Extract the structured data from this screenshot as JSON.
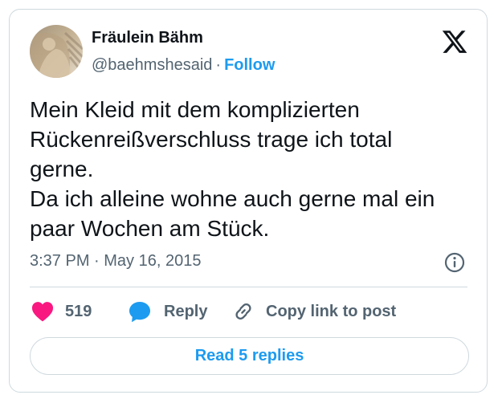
{
  "author": {
    "name": "Fräulein Bähm",
    "handle": "@baehmshesaid",
    "separator": "·",
    "follow_label": "Follow"
  },
  "tweet": {
    "lines": [
      "Mein Kleid mit dem komplizierten",
      "Rückenreißverschluss trage ich total",
      "gerne.",
      "Da ich alleine wohne auch gerne mal ein",
      "paar Wochen am Stück."
    ],
    "timestamp": "3:37 PM · May 16, 2015"
  },
  "actions": {
    "like_count": "519",
    "reply_label": "Reply",
    "copy_label": "Copy link to post"
  },
  "footer": {
    "read_replies_label": "Read 5 replies"
  },
  "icons": {
    "brand": "x-logo-icon",
    "info": "info-icon",
    "like": "heart-icon",
    "reply": "speech-bubble-icon",
    "copy": "link-icon"
  },
  "colors": {
    "accent": "#1d9bf0",
    "like": "#f91880",
    "text": "#0f1419",
    "secondary": "#536471",
    "border": "#cfd9de"
  }
}
